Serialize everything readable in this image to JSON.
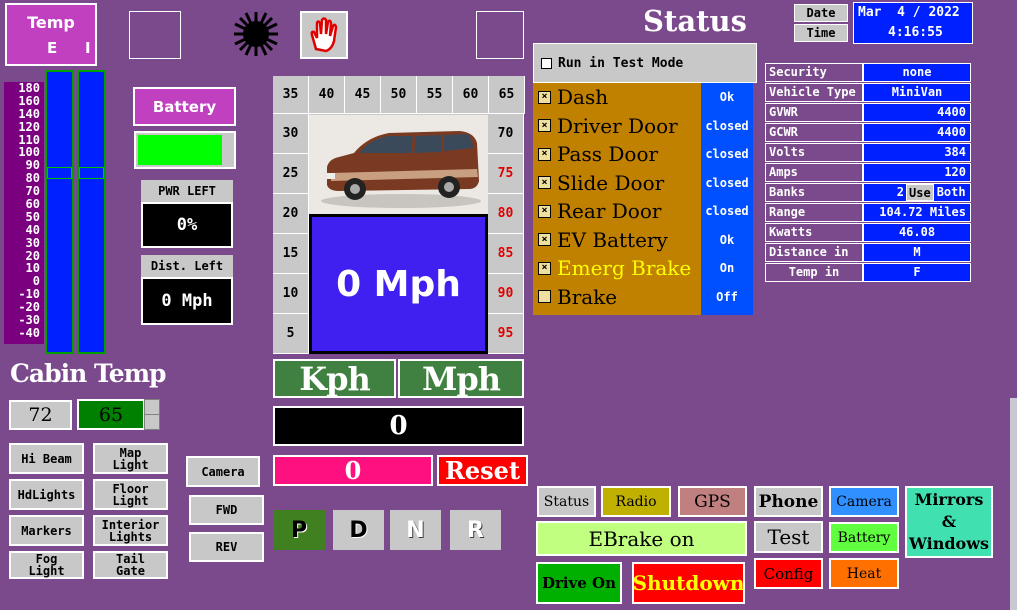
{
  "temp_box": {
    "title": "Temp",
    "e": "E",
    "i": "I"
  },
  "scale": [
    "180",
    "160",
    "140",
    "120",
    "110",
    "100",
    "90",
    "80",
    "70",
    "60",
    "50",
    "40",
    "30",
    "20",
    "10",
    "0",
    "-10",
    "-20",
    "-30",
    "-40"
  ],
  "battery_button": "Battery",
  "battery_level_pct": 88,
  "pwr_left": {
    "label": "PWR LEFT",
    "value": "0%"
  },
  "dist_left": {
    "label": "Dist. Left",
    "value": "0 Mph"
  },
  "cabin_temp": {
    "title": "Cabin Temp",
    "set": "72",
    "actual": "65"
  },
  "left_buttons": {
    "hi_beam": "Hi Beam",
    "map_light": [
      "Map",
      "Light"
    ],
    "hdlights": "HdLights",
    "floor_light": [
      "Floor",
      "Light"
    ],
    "markers": "Markers",
    "interior_lights": [
      "Interior",
      "Lights"
    ],
    "fog_light": [
      "Fog",
      "Light"
    ],
    "tail_gate": [
      "Tail",
      "Gate"
    ]
  },
  "camera_btn": "Camera",
  "fwd_btn": "FWD",
  "rev_btn": "REV",
  "speed_top": [
    "35",
    "40",
    "45",
    "50",
    "55",
    "60",
    "65"
  ],
  "speed_left": [
    "30",
    "25",
    "20",
    "15",
    "10",
    "5"
  ],
  "speed_right": [
    "70",
    "75",
    "80",
    "85",
    "90",
    "95"
  ],
  "speed_display": "0 Mph",
  "kph": "Kph",
  "mph": "Mph",
  "odometer": "0",
  "trip": "0",
  "reset": "Reset",
  "gears": [
    "P",
    "D",
    "N",
    "R"
  ],
  "status_title": "Status",
  "date": {
    "date_label": "Date",
    "date_value": "Mar  4 / 2022",
    "time_label": "Time",
    "time_value": "4:16:55"
  },
  "test_mode": "Run in Test Mode",
  "status_items": [
    {
      "label": "Dash",
      "value": "Ok",
      "checked": true
    },
    {
      "label": "Driver Door",
      "value": "closed",
      "checked": true
    },
    {
      "label": "Pass Door",
      "value": "closed",
      "checked": true
    },
    {
      "label": "Slide Door",
      "value": "closed",
      "checked": true
    },
    {
      "label": "Rear Door",
      "value": "closed",
      "checked": true
    },
    {
      "label": "EV Battery",
      "value": "Ok",
      "checked": true
    },
    {
      "label": "Emerg Brake",
      "value": "On",
      "checked": true
    },
    {
      "label": "Brake",
      "value": "Off",
      "checked": false
    }
  ],
  "info": {
    "security": {
      "k": "Security",
      "v": "none"
    },
    "vehicle_type": {
      "k": "Vehicle Type",
      "v": "MiniVan"
    },
    "gvwr": {
      "k": "GVWR",
      "v": "4400"
    },
    "gcwr": {
      "k": "GCWR",
      "v": "4400"
    },
    "volts": {
      "k": "Volts",
      "v": "384"
    },
    "amps": {
      "k": "Amps",
      "v": "120"
    },
    "banks": {
      "k": "Banks",
      "v1": "2",
      "v2": "Use",
      "v3": "Both"
    },
    "range": {
      "k": "Range",
      "v": "104.72 Miles"
    },
    "kwatts": {
      "k": "Kwatts",
      "v": "46.08"
    },
    "distance_in": {
      "k": "Distance in",
      "v": "M"
    },
    "temp_in": {
      "k": "Temp in",
      "v": "F"
    }
  },
  "bottom": {
    "status": "Status",
    "radio": "Radio",
    "gps": "GPS",
    "phone": "Phone",
    "camera": "Camera",
    "mirrors": [
      "Mirrors &",
      "Windows"
    ],
    "ebrake": "EBrake on",
    "test": "Test",
    "battery": "Battery",
    "drive_on": "Drive On",
    "shutdown": "Shutdown",
    "config": "Config",
    "heat": "Heat"
  }
}
